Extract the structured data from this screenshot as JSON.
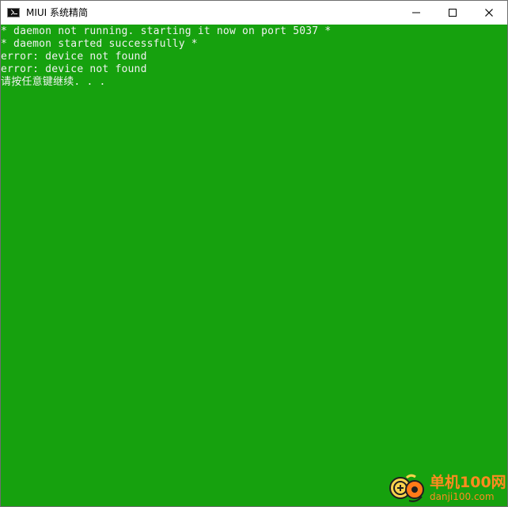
{
  "window": {
    "title": "MIUI 系统精简",
    "icon": "console-icon",
    "controls": {
      "minimize": "minimize-icon",
      "maximize": "maximize-icon",
      "close": "close-icon"
    },
    "colors": {
      "console_background": "#16a10e",
      "console_text": "#f2f2f2",
      "titlebar_background": "#ffffff"
    }
  },
  "console": {
    "lines": [
      "* daemon not running. starting it now on port 5037 *",
      "* daemon started successfully *",
      "error: device not found",
      "error: device not found",
      "请按任意键继续. . ."
    ]
  },
  "watermark": {
    "main_text": "单机100网",
    "sub_text": "danji100.com",
    "color": "#ff8b1f"
  }
}
